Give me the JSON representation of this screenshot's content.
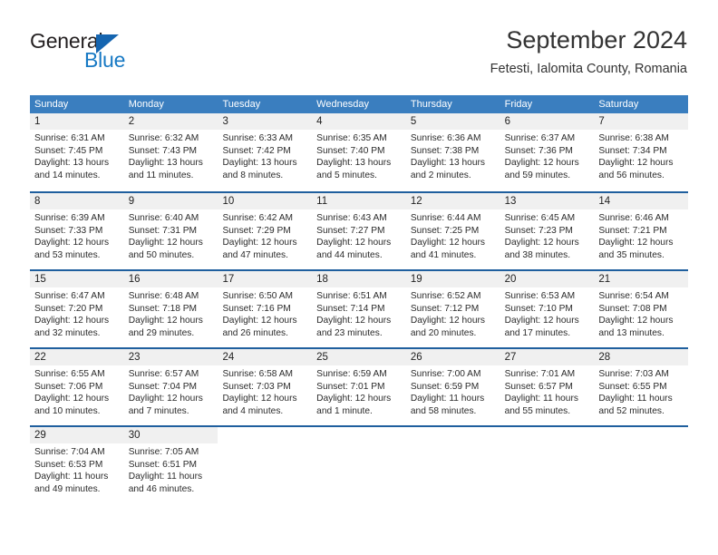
{
  "brand": {
    "name_part1": "General",
    "name_part2": "Blue",
    "accent_color": "#1779c4"
  },
  "header": {
    "title": "September 2024",
    "subtitle": "Fetesti, Ialomita County, Romania"
  },
  "theme": {
    "header_row_bg": "#3a7ebf",
    "week_separator": "#1f5f9e",
    "daynum_band_bg": "#f0f0f0"
  },
  "weekdays": [
    "Sunday",
    "Monday",
    "Tuesday",
    "Wednesday",
    "Thursday",
    "Friday",
    "Saturday"
  ],
  "weeks": [
    [
      {
        "day": "1",
        "lines": [
          "Sunrise: 6:31 AM",
          "Sunset: 7:45 PM",
          "Daylight: 13 hours",
          "and 14 minutes."
        ]
      },
      {
        "day": "2",
        "lines": [
          "Sunrise: 6:32 AM",
          "Sunset: 7:43 PM",
          "Daylight: 13 hours",
          "and 11 minutes."
        ]
      },
      {
        "day": "3",
        "lines": [
          "Sunrise: 6:33 AM",
          "Sunset: 7:42 PM",
          "Daylight: 13 hours",
          "and 8 minutes."
        ]
      },
      {
        "day": "4",
        "lines": [
          "Sunrise: 6:35 AM",
          "Sunset: 7:40 PM",
          "Daylight: 13 hours",
          "and 5 minutes."
        ]
      },
      {
        "day": "5",
        "lines": [
          "Sunrise: 6:36 AM",
          "Sunset: 7:38 PM",
          "Daylight: 13 hours",
          "and 2 minutes."
        ]
      },
      {
        "day": "6",
        "lines": [
          "Sunrise: 6:37 AM",
          "Sunset: 7:36 PM",
          "Daylight: 12 hours",
          "and 59 minutes."
        ]
      },
      {
        "day": "7",
        "lines": [
          "Sunrise: 6:38 AM",
          "Sunset: 7:34 PM",
          "Daylight: 12 hours",
          "and 56 minutes."
        ]
      }
    ],
    [
      {
        "day": "8",
        "lines": [
          "Sunrise: 6:39 AM",
          "Sunset: 7:33 PM",
          "Daylight: 12 hours",
          "and 53 minutes."
        ]
      },
      {
        "day": "9",
        "lines": [
          "Sunrise: 6:40 AM",
          "Sunset: 7:31 PM",
          "Daylight: 12 hours",
          "and 50 minutes."
        ]
      },
      {
        "day": "10",
        "lines": [
          "Sunrise: 6:42 AM",
          "Sunset: 7:29 PM",
          "Daylight: 12 hours",
          "and 47 minutes."
        ]
      },
      {
        "day": "11",
        "lines": [
          "Sunrise: 6:43 AM",
          "Sunset: 7:27 PM",
          "Daylight: 12 hours",
          "and 44 minutes."
        ]
      },
      {
        "day": "12",
        "lines": [
          "Sunrise: 6:44 AM",
          "Sunset: 7:25 PM",
          "Daylight: 12 hours",
          "and 41 minutes."
        ]
      },
      {
        "day": "13",
        "lines": [
          "Sunrise: 6:45 AM",
          "Sunset: 7:23 PM",
          "Daylight: 12 hours",
          "and 38 minutes."
        ]
      },
      {
        "day": "14",
        "lines": [
          "Sunrise: 6:46 AM",
          "Sunset: 7:21 PM",
          "Daylight: 12 hours",
          "and 35 minutes."
        ]
      }
    ],
    [
      {
        "day": "15",
        "lines": [
          "Sunrise: 6:47 AM",
          "Sunset: 7:20 PM",
          "Daylight: 12 hours",
          "and 32 minutes."
        ]
      },
      {
        "day": "16",
        "lines": [
          "Sunrise: 6:48 AM",
          "Sunset: 7:18 PM",
          "Daylight: 12 hours",
          "and 29 minutes."
        ]
      },
      {
        "day": "17",
        "lines": [
          "Sunrise: 6:50 AM",
          "Sunset: 7:16 PM",
          "Daylight: 12 hours",
          "and 26 minutes."
        ]
      },
      {
        "day": "18",
        "lines": [
          "Sunrise: 6:51 AM",
          "Sunset: 7:14 PM",
          "Daylight: 12 hours",
          "and 23 minutes."
        ]
      },
      {
        "day": "19",
        "lines": [
          "Sunrise: 6:52 AM",
          "Sunset: 7:12 PM",
          "Daylight: 12 hours",
          "and 20 minutes."
        ]
      },
      {
        "day": "20",
        "lines": [
          "Sunrise: 6:53 AM",
          "Sunset: 7:10 PM",
          "Daylight: 12 hours",
          "and 17 minutes."
        ]
      },
      {
        "day": "21",
        "lines": [
          "Sunrise: 6:54 AM",
          "Sunset: 7:08 PM",
          "Daylight: 12 hours",
          "and 13 minutes."
        ]
      }
    ],
    [
      {
        "day": "22",
        "lines": [
          "Sunrise: 6:55 AM",
          "Sunset: 7:06 PM",
          "Daylight: 12 hours",
          "and 10 minutes."
        ]
      },
      {
        "day": "23",
        "lines": [
          "Sunrise: 6:57 AM",
          "Sunset: 7:04 PM",
          "Daylight: 12 hours",
          "and 7 minutes."
        ]
      },
      {
        "day": "24",
        "lines": [
          "Sunrise: 6:58 AM",
          "Sunset: 7:03 PM",
          "Daylight: 12 hours",
          "and 4 minutes."
        ]
      },
      {
        "day": "25",
        "lines": [
          "Sunrise: 6:59 AM",
          "Sunset: 7:01 PM",
          "Daylight: 12 hours",
          "and 1 minute."
        ]
      },
      {
        "day": "26",
        "lines": [
          "Sunrise: 7:00 AM",
          "Sunset: 6:59 PM",
          "Daylight: 11 hours",
          "and 58 minutes."
        ]
      },
      {
        "day": "27",
        "lines": [
          "Sunrise: 7:01 AM",
          "Sunset: 6:57 PM",
          "Daylight: 11 hours",
          "and 55 minutes."
        ]
      },
      {
        "day": "28",
        "lines": [
          "Sunrise: 7:03 AM",
          "Sunset: 6:55 PM",
          "Daylight: 11 hours",
          "and 52 minutes."
        ]
      }
    ],
    [
      {
        "day": "29",
        "lines": [
          "Sunrise: 7:04 AM",
          "Sunset: 6:53 PM",
          "Daylight: 11 hours",
          "and 49 minutes."
        ]
      },
      {
        "day": "30",
        "lines": [
          "Sunrise: 7:05 AM",
          "Sunset: 6:51 PM",
          "Daylight: 11 hours",
          "and 46 minutes."
        ]
      },
      {
        "day": "",
        "lines": []
      },
      {
        "day": "",
        "lines": []
      },
      {
        "day": "",
        "lines": []
      },
      {
        "day": "",
        "lines": []
      },
      {
        "day": "",
        "lines": []
      }
    ]
  ]
}
